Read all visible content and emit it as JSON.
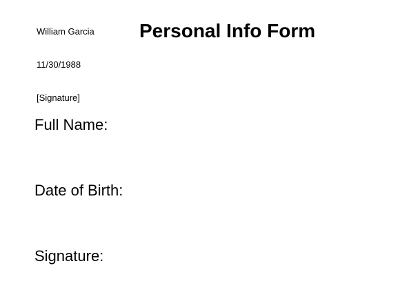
{
  "form": {
    "title": "Personal Info Form",
    "values": {
      "full_name": "William Garcia",
      "date_of_birth": "11/30/1988",
      "signature": "[Signature]"
    },
    "labels": {
      "full_name": "Full Name:",
      "date_of_birth": "Date of Birth:",
      "signature": "Signature:"
    }
  },
  "colors": {
    "background": "#ffffff",
    "text": "#000000"
  }
}
